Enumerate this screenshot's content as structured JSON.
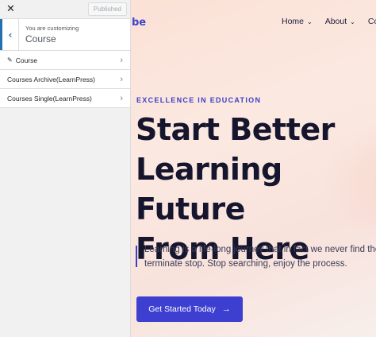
{
  "customizer": {
    "close_icon": "close-icon",
    "published_label": "Published",
    "customizing_small": "You are customizing",
    "customizing_title": "Course",
    "menu": [
      {
        "label": "Course",
        "icon": "pencil-icon"
      },
      {
        "label": "Courses Archive(LearnPress)"
      },
      {
        "label": "Courses Single(LearnPress)"
      }
    ]
  },
  "preview": {
    "logo_fragment": "be",
    "nav": [
      {
        "label": "Home"
      },
      {
        "label": "About"
      },
      {
        "label": "Cours"
      }
    ],
    "eyebrow": "EXCELLENCE IN EDUCATION",
    "headline_lines": [
      "Start Better",
      "Learning Future",
      "From Here"
    ],
    "description_lines": [
      "Learning is a life-long journey that in fact we never find the",
      "terminate stop. Stop searching, enjoy the process."
    ],
    "cta_label": "Get Started Today",
    "colors": {
      "accent": "#3d3fd0",
      "headline": "#16152e",
      "wp_blue": "#2271b1"
    }
  }
}
